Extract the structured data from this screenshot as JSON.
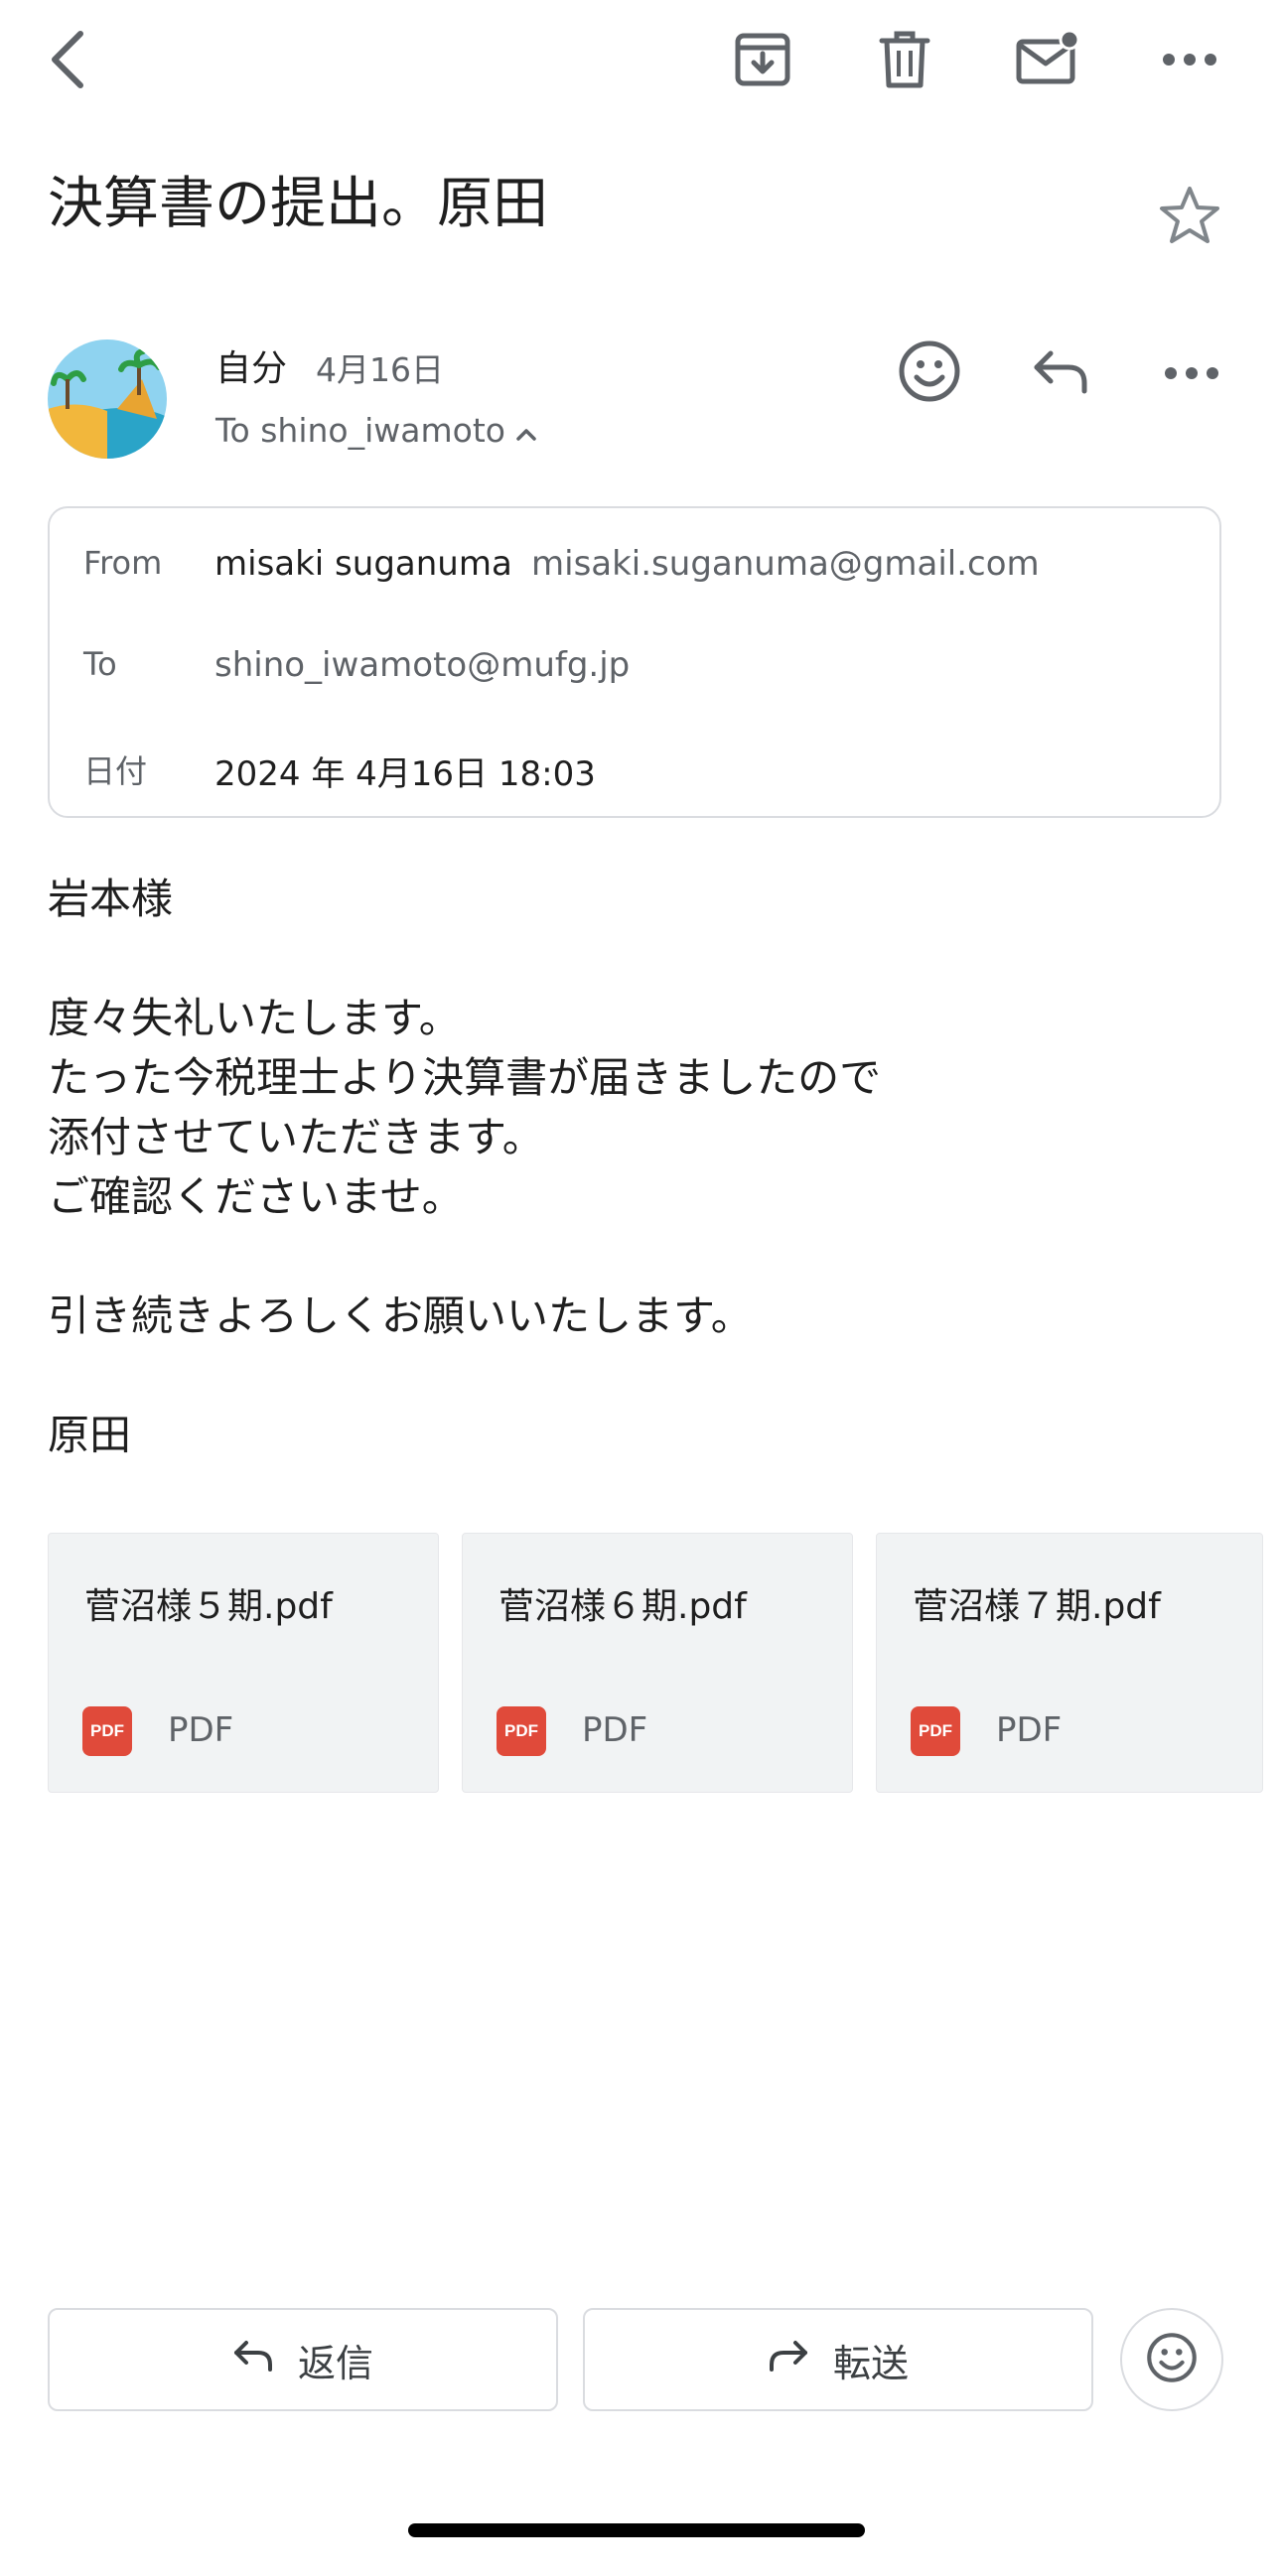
{
  "toolbar": {
    "back_icon": "chevron-left-icon",
    "archive_icon": "archive-icon",
    "delete_icon": "trash-icon",
    "mark_unread_icon": "mail-unread-icon",
    "more_icon": "more-horizontal-icon"
  },
  "subject": "決算書の提出。原田",
  "message": {
    "sender": "自分",
    "date": "4月16日",
    "to_summary": "To shino_iwamoto",
    "details": {
      "from_label": "From",
      "from_name": "misaki suganuma",
      "from_email": "misaki.suganuma@gmail.com",
      "to_label": "To",
      "to_email": "shino_iwamoto@mufg.jp",
      "date_label": "日付",
      "date_value": "2024 年 4月16日 18:03"
    },
    "body": "岩本様\n\n度々失礼いたします。\nたった今税理士より決算書が届きましたので\n添付させていただきます。\nご確認くださいませ。\n\n引き続きよろしくお願いいたします。\n\n原田"
  },
  "attachments": [
    {
      "name": "菅沼様５期.pdf",
      "badge": "PDF",
      "type": "PDF"
    },
    {
      "name": "菅沼様６期.pdf",
      "badge": "PDF",
      "type": "PDF"
    },
    {
      "name": "菅沼様７期.pdf",
      "badge": "PDF",
      "type": "PDF"
    }
  ],
  "actions": {
    "reply_label": "返信",
    "forward_label": "転送"
  },
  "colors": {
    "accent_pdf": "#e04a3a",
    "icon_grey": "#5f6368",
    "border": "#dadce0",
    "attachment_bg": "#f1f3f4"
  }
}
